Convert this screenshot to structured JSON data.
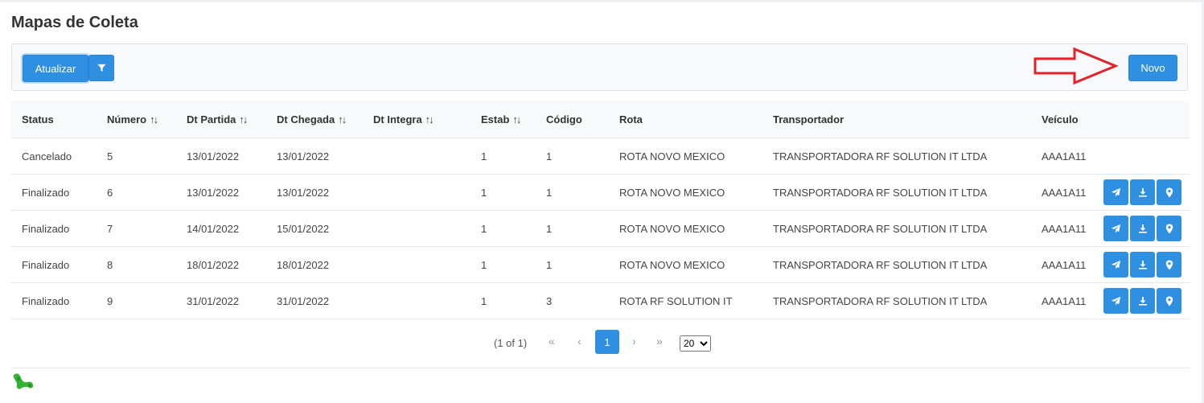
{
  "page": {
    "title": "Mapas de Coleta"
  },
  "toolbar": {
    "refresh_label": "Atualizar",
    "filter_icon": "filter-icon",
    "new_label": "Novo",
    "annotation_arrow_color": "#e0232b"
  },
  "table": {
    "headers": [
      "Status",
      "Número",
      "Dt Partida",
      "Dt Chegada",
      "Dt Integra",
      "Estab",
      "Código",
      "Rota",
      "Transportador",
      "Veículo",
      ""
    ],
    "sortable": [
      false,
      true,
      true,
      true,
      true,
      true,
      false,
      false,
      false,
      false,
      false
    ],
    "sort_icon": "↑↓",
    "rows": [
      {
        "status": "Cancelado",
        "numero": "5",
        "partida": "13/01/2022",
        "chegada": "13/01/2022",
        "integra": "",
        "estab": "1",
        "codigo": "1",
        "rota": "ROTA NOVO MEXICO",
        "transportador": "TRANSPORTADORA RF SOLUTION IT LTDA",
        "veiculo": "AAA1A11",
        "actions": false
      },
      {
        "status": "Finalizado",
        "numero": "6",
        "partida": "13/01/2022",
        "chegada": "13/01/2022",
        "integra": "",
        "estab": "1",
        "codigo": "1",
        "rota": "ROTA NOVO MEXICO",
        "transportador": "TRANSPORTADORA RF SOLUTION IT LTDA",
        "veiculo": "AAA1A11",
        "actions": true
      },
      {
        "status": "Finalizado",
        "numero": "7",
        "partida": "14/01/2022",
        "chegada": "15/01/2022",
        "integra": "",
        "estab": "1",
        "codigo": "1",
        "rota": "ROTA NOVO MEXICO",
        "transportador": "TRANSPORTADORA RF SOLUTION IT LTDA",
        "veiculo": "AAA1A11",
        "actions": true
      },
      {
        "status": "Finalizado",
        "numero": "8",
        "partida": "18/01/2022",
        "chegada": "18/01/2022",
        "integra": "",
        "estab": "1",
        "codigo": "1",
        "rota": "ROTA NOVO MEXICO",
        "transportador": "TRANSPORTADORA RF SOLUTION IT LTDA",
        "veiculo": "AAA1A11",
        "actions": true
      },
      {
        "status": "Finalizado",
        "numero": "9",
        "partida": "31/01/2022",
        "chegada": "31/01/2022",
        "integra": "",
        "estab": "1",
        "codigo": "3",
        "rota": "ROTA RF SOLUTION IT",
        "transportador": "TRANSPORTADORA RF SOLUTION IT LTDA",
        "veiculo": "AAA1A11",
        "actions": true
      }
    ],
    "action_icons": [
      "send-icon",
      "download-icon",
      "map-marker-icon"
    ]
  },
  "pager": {
    "info": "(1 of 1)",
    "first": "«",
    "prev": "‹",
    "current": "1",
    "next": "›",
    "last": "»",
    "page_size": "20",
    "page_size_options": [
      "20"
    ]
  },
  "colors": {
    "primary": "#2f8fe0",
    "header_bg": "#f8f9fb",
    "border": "#e4e7eb"
  }
}
